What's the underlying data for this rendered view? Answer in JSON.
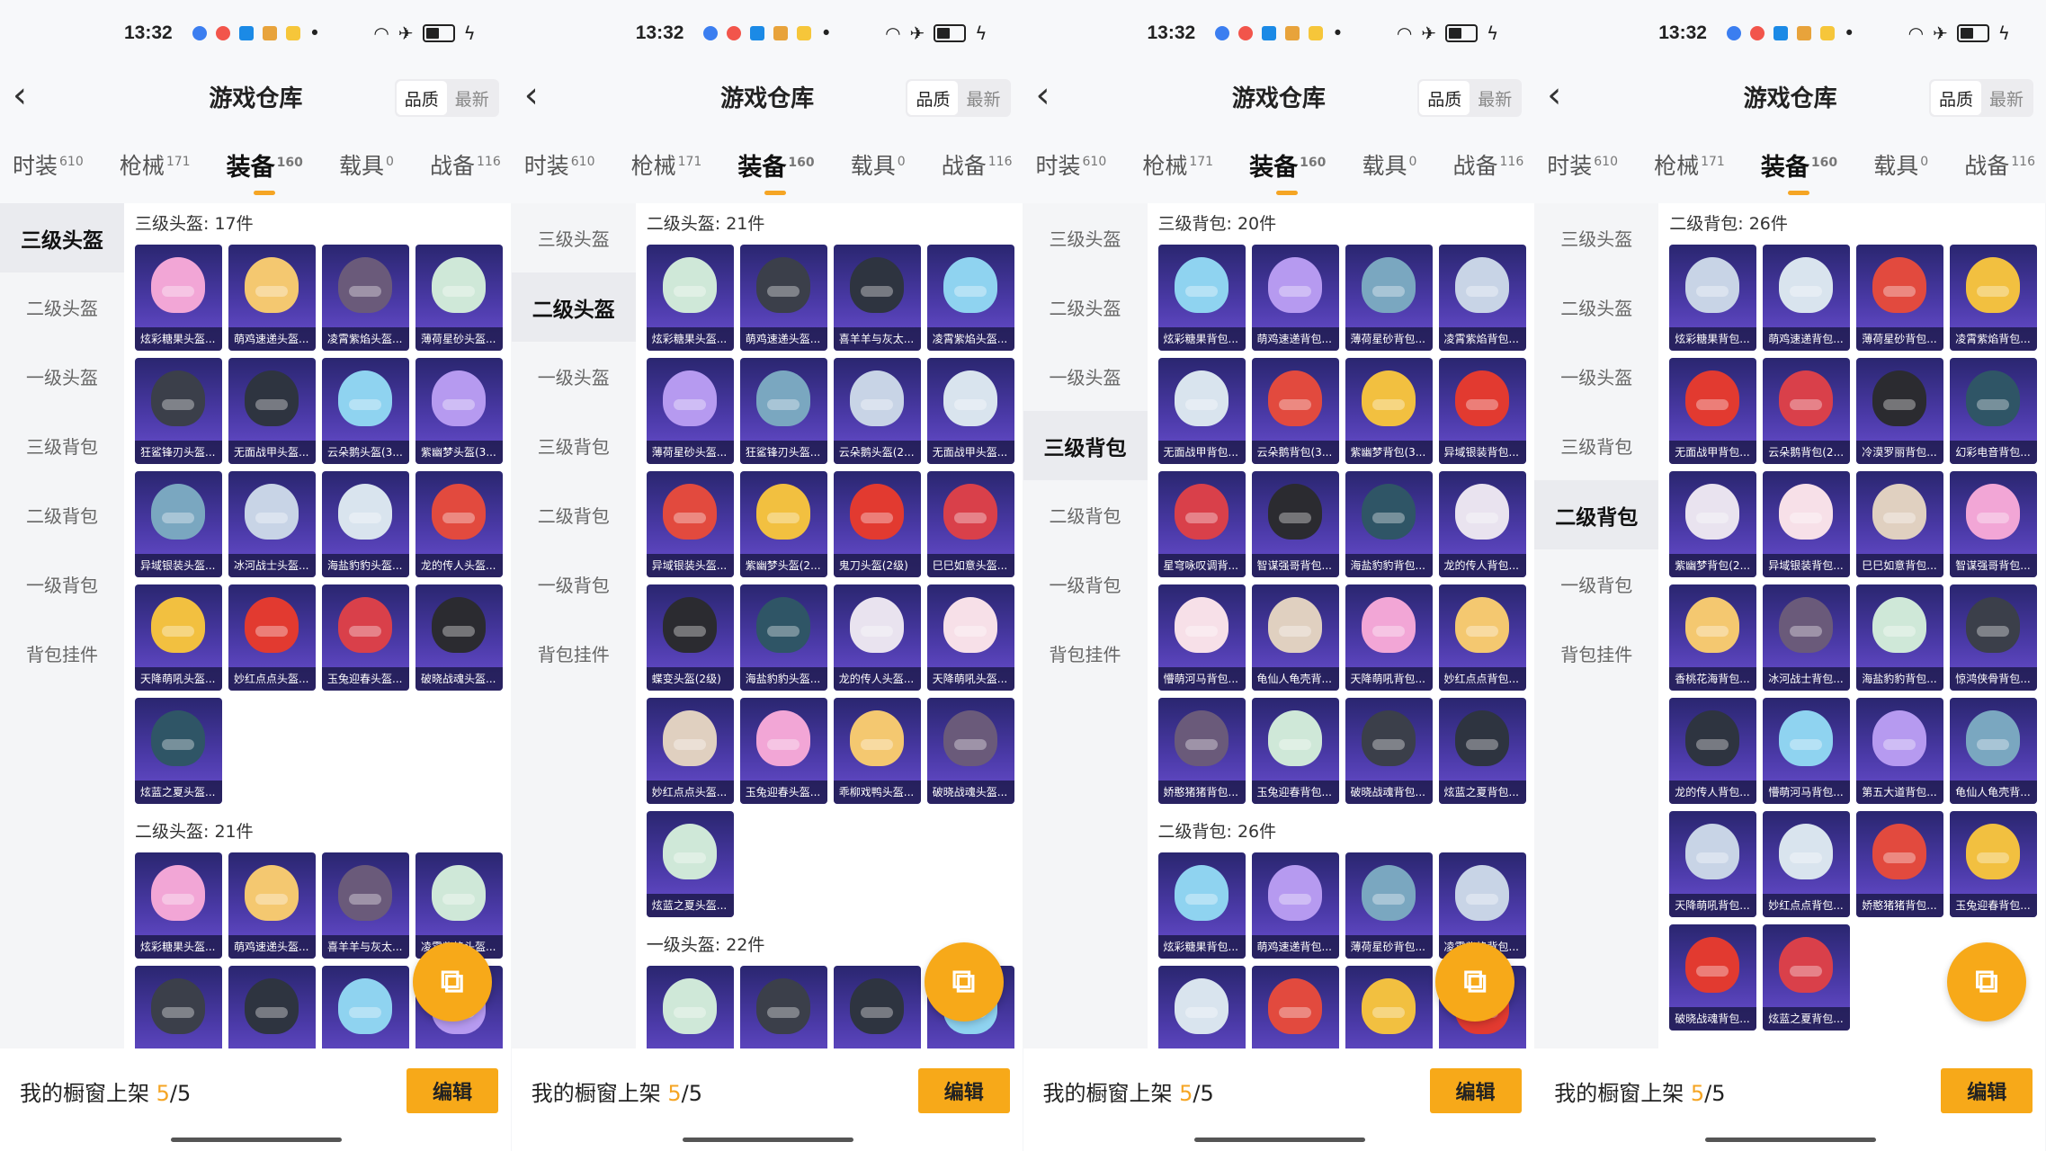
{
  "status": {
    "time": "13:32"
  },
  "colors": {
    "accent": "#f7a919",
    "card_top": "#2a2670",
    "card_bottom": "#6a4fd0"
  },
  "header": {
    "title": "游戏仓库",
    "toggle": [
      "品质",
      "最新"
    ]
  },
  "tabs": [
    {
      "label": "时装",
      "count": "610"
    },
    {
      "label": "枪械",
      "count": "171"
    },
    {
      "label": "装备",
      "count": "160"
    },
    {
      "label": "载具",
      "count": "0"
    },
    {
      "label": "战备",
      "count": "116"
    }
  ],
  "sidebar": [
    "三级头盔",
    "二级头盔",
    "一级头盔",
    "三级背包",
    "二级背包",
    "一级背包",
    "背包挂件"
  ],
  "footer": {
    "label_prefix": "我的橱窗上架 ",
    "count": "5",
    "total": "/5",
    "edit": "编辑"
  },
  "panels": [
    {
      "active_side": 0,
      "sections": [
        {
          "title": "三级头盔: 17件",
          "items": [
            "炫彩糖果头盔...",
            "萌鸡速递头盔...",
            "凌霄紫焰头盔...",
            "薄荷星砂头盔...",
            "狂鲨锋刃头盔...",
            "无面战甲头盔...",
            "云朵鹅头盔(3...",
            "紫幽梦头盔(3...",
            "异域银装头盔...",
            "冰河战士头盔...",
            "海盐豹豹头盔...",
            "龙的传人头盔...",
            "天降萌吼头盔...",
            "妙红点点头盔...",
            "玉兔迎春头盔...",
            "破晓战魂头盔...",
            "炫蓝之夏头盔..."
          ]
        },
        {
          "title": "二级头盔: 21件",
          "items": [
            "炫彩糖果头盔...",
            "萌鸡速递头盔...",
            "喜羊羊与灰太...",
            "凌霄紫焰头盔...",
            "",
            "",
            "",
            ""
          ]
        }
      ]
    },
    {
      "active_side": 1,
      "sections": [
        {
          "title": "二级头盔: 21件",
          "items": [
            "炫彩糖果头盔...",
            "萌鸡速递头盔...",
            "喜羊羊与灰太...",
            "凌霄紫焰头盔...",
            "薄荷星砂头盔...",
            "狂鲨锋刃头盔...",
            "云朵鹅头盔(2...",
            "无面战甲头盔...",
            "异域银装头盔...",
            "紫幽梦头盔(2...",
            "鬼刀头盔(2级)",
            "巳巳如意头盔...",
            "蝶变头盔(2级)",
            "海盐豹豹头盔...",
            "龙的传人头盔...",
            "天降萌吼头盔...",
            "妙红点点头盔...",
            "玉兔迎春头盔...",
            "乖柳戏鸭头盔...",
            "破晓战魂头盔...",
            "炫蓝之夏头盔..."
          ]
        },
        {
          "title": "一级头盔: 22件",
          "items": [
            "",
            "",
            "",
            ""
          ]
        }
      ]
    },
    {
      "active_side": 3,
      "sections": [
        {
          "title": "三级背包: 20件",
          "items": [
            "炫彩糖果背包...",
            "萌鸡速递背包...",
            "薄荷星砂背包...",
            "凌霄紫焰背包...",
            "无面战甲背包...",
            "云朵鹅背包(3...",
            "紫幽梦背包(3...",
            "异域银装背包...",
            "星穹咏叹调背...",
            "智谋强哥背包...",
            "海盐豹豹背包...",
            "龙的传人背包...",
            "懵萌河马背包...",
            "龟仙人龟壳背...",
            "天降萌吼背包...",
            "妙红点点背包...",
            "娇憨猪猪背包...",
            "玉兔迎春背包...",
            "破晓战魂背包...",
            "炫蓝之夏背包..."
          ]
        },
        {
          "title": "二级背包: 26件",
          "items": [
            "炫彩糖果背包...",
            "萌鸡速递背包...",
            "薄荷星砂背包...",
            "凌霄紫焰背包...",
            "",
            "",
            "",
            ""
          ]
        }
      ]
    },
    {
      "active_side": 4,
      "sections": [
        {
          "title": "二级背包: 26件",
          "items": [
            "炫彩糖果背包...",
            "萌鸡速递背包...",
            "薄荷星砂背包...",
            "凌霄紫焰背包...",
            "无面战甲背包...",
            "云朵鹅背包(2...",
            "冷漠罗丽背包...",
            "幻彩电音背包...",
            "紫幽梦背包(2...",
            "异域银装背包...",
            "巳巳如意背包...",
            "智谋强哥背包...",
            "香桃花海背包...",
            "冰河战士背包...",
            "海盐豹豹背包...",
            "惊鸿侠骨背包...",
            "龙的传人背包...",
            "懵萌河马背包...",
            "第五大道背包...",
            "龟仙人龟壳背...",
            "天降萌吼背包...",
            "妙红点点背包...",
            "娇憨猪猪背包...",
            "玉兔迎春背包...",
            "破晓战魂背包...",
            "炫蓝之夏背包..."
          ]
        }
      ]
    }
  ]
}
